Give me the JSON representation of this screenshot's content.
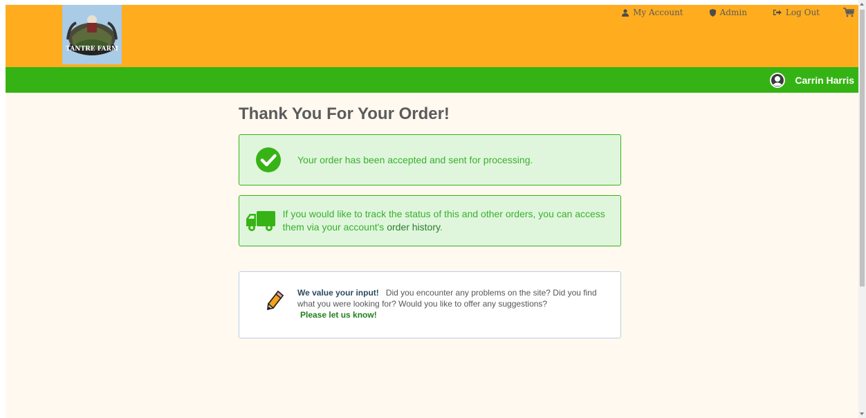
{
  "header": {
    "logo_text": "TANTRE FARM",
    "nav": {
      "my_account": "My Account",
      "admin": "Admin",
      "log_out": "Log Out"
    }
  },
  "userbar": {
    "user_name": "Carrin Harris"
  },
  "main": {
    "title": "Thank You For Your Order!",
    "alert_accepted": "Your order has been accepted and sent for processing.",
    "alert_track_text": "If you would like to track the status of this and other orders, you can access them via your account's",
    "alert_track_link": "order history",
    "alert_track_end": ".",
    "feedback": {
      "lead": "We value your input!",
      "text": "Did you encounter any problems on the site? Did you find what you were looking for? Would you like to offer any suggestions?",
      "link": "Please let us know!"
    }
  },
  "colors": {
    "header": "#ffad1f",
    "userbar": "#36b314",
    "alert_bg": "#dff6dd",
    "alert_border": "#37b316"
  },
  "icons": {
    "my_account": "user-icon",
    "admin": "shield-icon",
    "log_out": "logout-icon",
    "cart": "cart-icon",
    "avatar": "avatar-icon",
    "accepted": "check-circle-icon",
    "track": "truck-icon",
    "feedback": "pencil-icon"
  }
}
